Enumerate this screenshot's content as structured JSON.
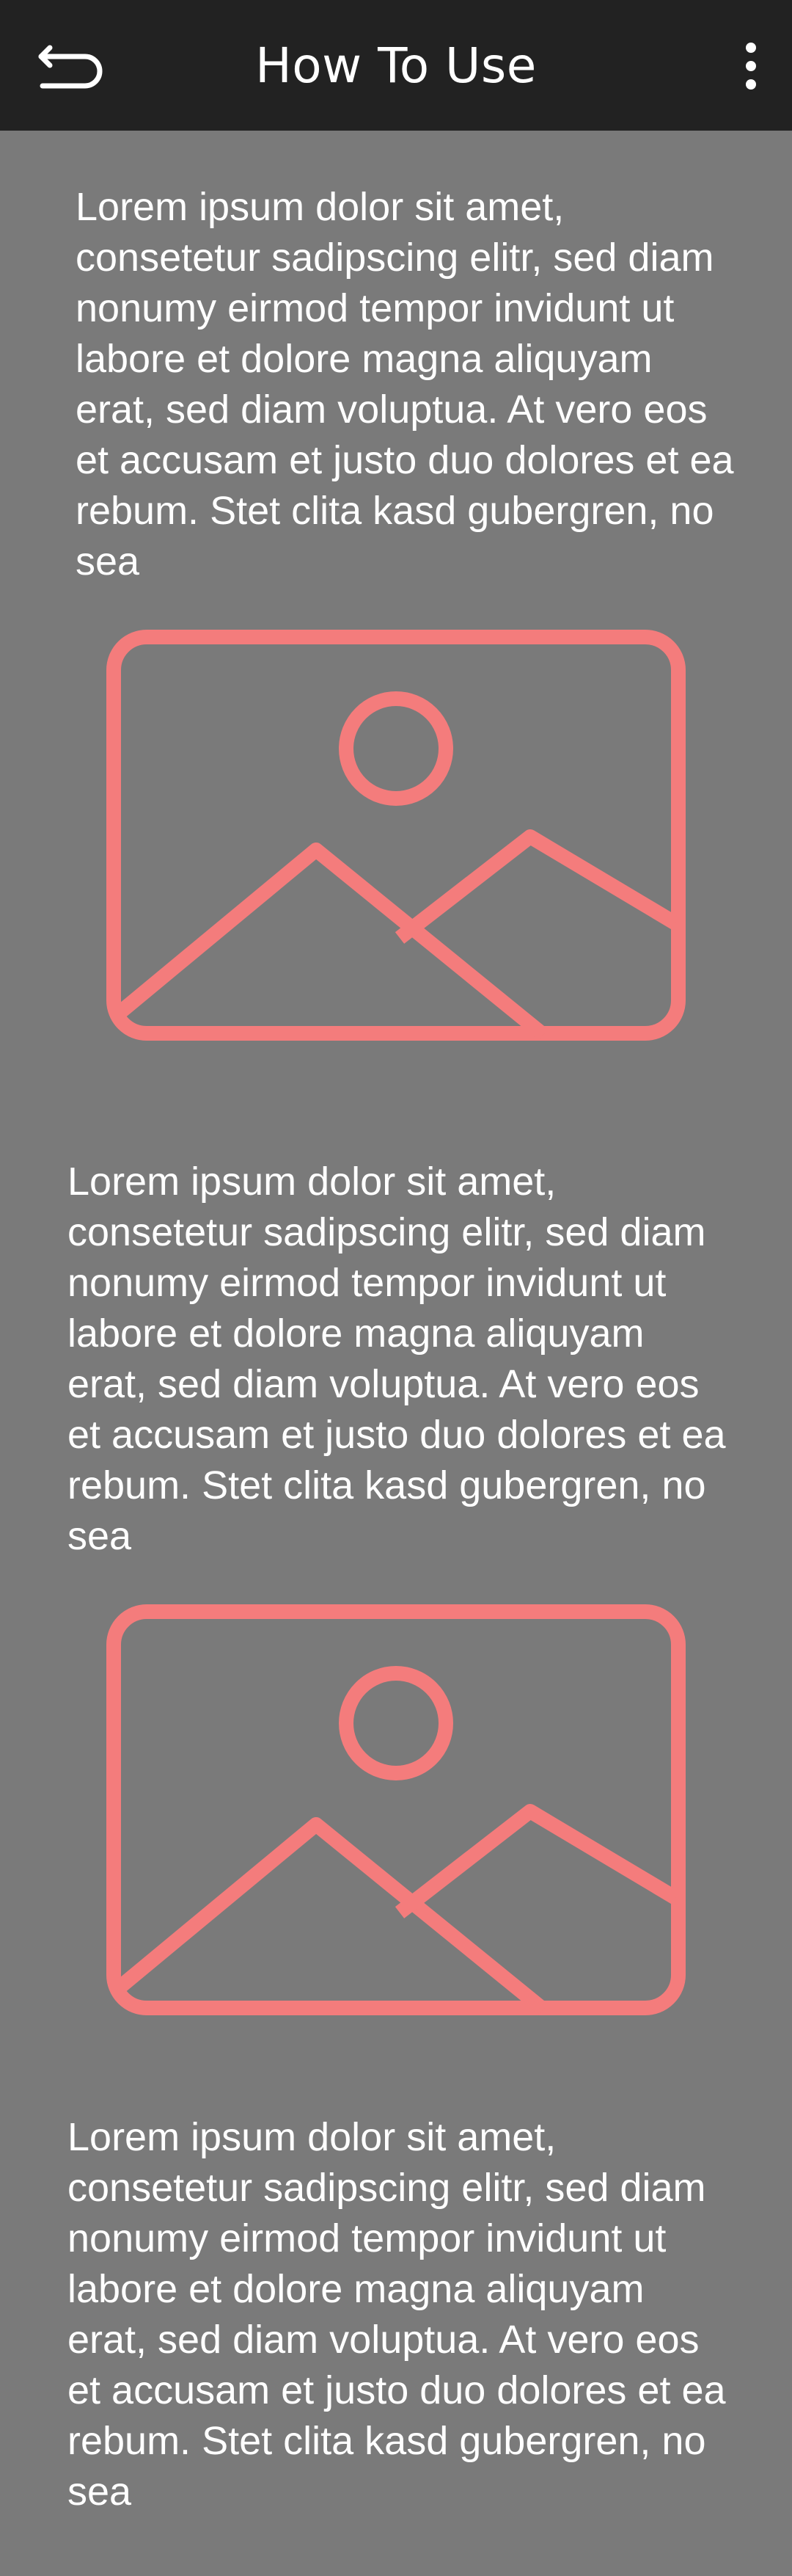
{
  "app_bar": {
    "title": "How To Use",
    "back_icon": "back-arrow-icon",
    "menu_icon": "more-vert-icon"
  },
  "colors": {
    "app_bar_background": "#222222",
    "page_background": "#7a7a7a",
    "text": "#ffffff",
    "image_placeholder": "#f47c7c"
  },
  "sections": [
    {
      "text": "Lorem ipsum dolor sit amet, consetetur sadipscing elitr, sed diam nonumy eirmod tempor invidunt ut labore et dolore magna aliquyam erat, sed diam voluptua. At vero eos et accusam et justo duo dolores et ea rebum. Stet clita kasd gubergren, no sea",
      "image_icon": "image-placeholder-icon"
    },
    {
      "text": "Lorem ipsum dolor sit amet, consetetur sadipscing elitr, sed diam nonumy eirmod tempor invidunt ut labore et dolore magna aliquyam erat, sed diam voluptua. At vero eos et accusam et justo duo dolores et ea rebum. Stet clita kasd gubergren, no sea",
      "image_icon": "image-placeholder-icon"
    },
    {
      "text": "Lorem ipsum dolor sit amet, consetetur sadipscing elitr, sed diam nonumy eirmod tempor invidunt ut labore et dolore magna aliquyam erat, sed diam voluptua. At vero eos et accusam et justo duo dolores et ea rebum. Stet clita kasd gubergren, no sea"
    }
  ]
}
